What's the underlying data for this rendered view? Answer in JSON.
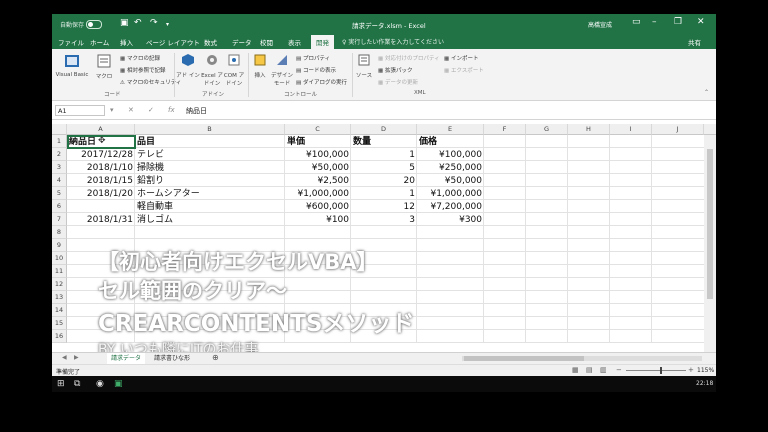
{
  "titlebar": {
    "autosave": "自動保存",
    "autosave_state": "オフ",
    "title": "請求データ.xlsm - Excel",
    "user": "高橋宣成",
    "brand_color": "#217346"
  },
  "tabs": [
    "ファイル",
    "ホーム",
    "挿入",
    "ページ レイアウト",
    "数式",
    "データ",
    "校閲",
    "表示",
    "開発"
  ],
  "active_tab": "開発",
  "tell_me": "実行したい作業を入力してください",
  "share": "共有",
  "ribbon": {
    "code": {
      "visual_basic": "Visual Basic",
      "macro": "マクロ",
      "record": "マクロの記録",
      "relative": "相対参照で記録",
      "security": "マクロのセキュリティ",
      "group": "コード"
    },
    "addins": {
      "addin": "アド イン",
      "excel_addin": "Excel アドイン",
      "com_addin": "COM アドイン",
      "group": "アドイン"
    },
    "controls": {
      "insert": "挿入",
      "design_mode": "デザイン モード",
      "properties": "プロパティ",
      "view_code": "コードの表示",
      "run_dialog": "ダイアログの実行",
      "group": "コントロール"
    },
    "xml": {
      "source": "ソース",
      "map_properties": "対応付けのプロパティ",
      "expansion_packs": "拡張パック",
      "refresh_data": "データの更新",
      "import": "インポート",
      "export": "エクスポート",
      "group": "XML"
    }
  },
  "formula_bar": {
    "name_box": "A1",
    "value": "納品日"
  },
  "columns": [
    "A",
    "B",
    "C",
    "D",
    "E",
    "F",
    "G",
    "H",
    "I",
    "J"
  ],
  "rows": [
    "1",
    "2",
    "3",
    "4",
    "5",
    "6",
    "7",
    "8",
    "9",
    "10",
    "11",
    "12",
    "13",
    "14",
    "15",
    "16"
  ],
  "table": {
    "headers": [
      "納品日",
      "品目",
      "単価",
      "数量",
      "価格"
    ],
    "rows": [
      [
        "2017/12/28",
        "テレビ",
        "¥100,000",
        "1",
        "¥100,000"
      ],
      [
        "2018/1/10",
        "掃除機",
        "¥50,000",
        "5",
        "¥250,000"
      ],
      [
        "2018/1/15",
        "鉛割り",
        "¥2,500",
        "20",
        "¥50,000"
      ],
      [
        "2018/1/20",
        "ホームシアター",
        "¥1,000,000",
        "1",
        "¥1,000,000"
      ],
      [
        "",
        "軽自動車",
        "¥600,000",
        "12",
        "¥7,200,000"
      ],
      [
        "2018/1/31",
        "消しゴム",
        "¥100",
        "3",
        "¥300"
      ]
    ]
  },
  "overlay": {
    "line1": "【初心者向けエクセルVBA】",
    "line2": "セル範囲のクリア～",
    "line3": "CREARCONTENTSメソッド",
    "line4": "BY いつも隣にITのお仕事"
  },
  "sheets": [
    "請求データ",
    "請求書ひな形"
  ],
  "active_sheet": "請求データ",
  "status": {
    "ready": "準備完了",
    "zoom": "115%"
  },
  "taskbar": {
    "clock": "22:18"
  }
}
